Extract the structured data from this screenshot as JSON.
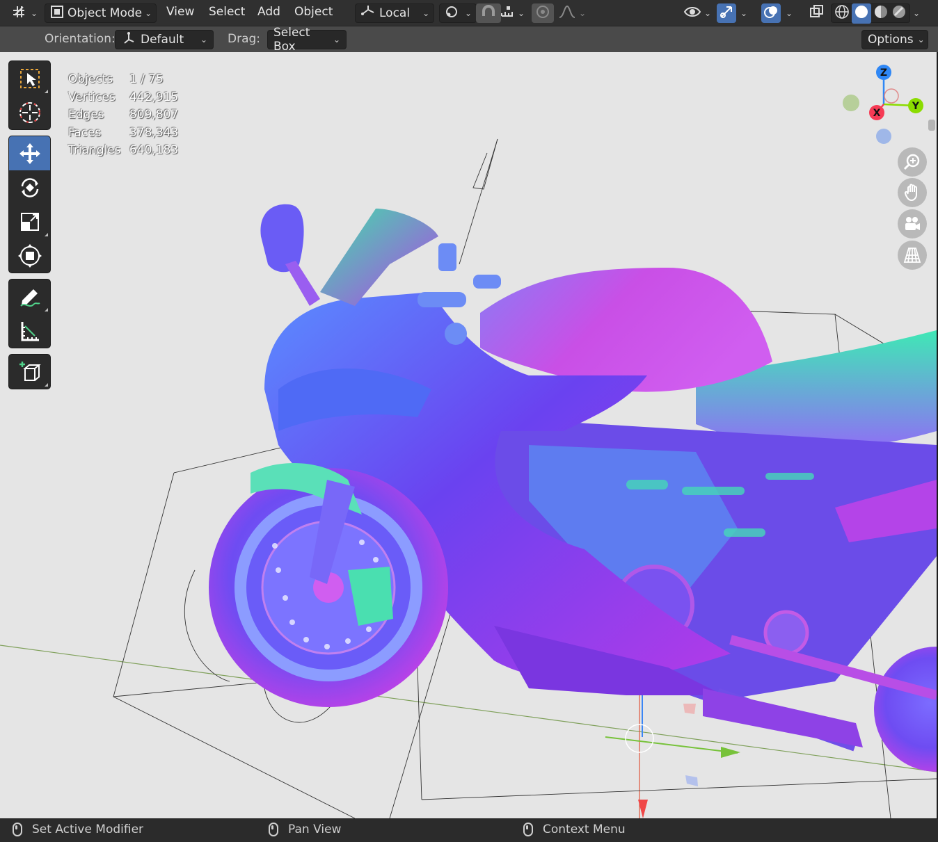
{
  "header": {
    "editor_type_icon": "axis-grid-icon",
    "mode_label": "Object Mode",
    "menus": [
      "View",
      "Select",
      "Add",
      "Object"
    ],
    "transform_orientation": "Local"
  },
  "tool_settings": {
    "orientation_label": "Orientation:",
    "orientation_value": "Default",
    "drag_label": "Drag:",
    "drag_value": "Select Box",
    "options_label": "Options"
  },
  "stats": {
    "rows": [
      {
        "label": "Objects",
        "value": "1 / 75"
      },
      {
        "label": "Vertices",
        "value": "442,915"
      },
      {
        "label": "Edges",
        "value": "809,807"
      },
      {
        "label": "Faces",
        "value": "378,343"
      },
      {
        "label": "Triangles",
        "value": "640,183"
      }
    ]
  },
  "gizmo": {
    "x_label": "X",
    "y_label": "Y",
    "z_label": "Z",
    "x_color": "#f63b55",
    "y_color": "#8bdc00",
    "z_color": "#2f87f5"
  },
  "tools": [
    {
      "name": "select-box-tool",
      "icon": "select-box-icon",
      "active": false
    },
    {
      "name": "cursor-tool",
      "icon": "cursor-icon",
      "active": false
    },
    {
      "name": "move-tool",
      "icon": "move-icon",
      "active": true
    },
    {
      "name": "rotate-tool",
      "icon": "rotate-icon",
      "active": false
    },
    {
      "name": "scale-tool",
      "icon": "scale-icon",
      "active": false
    },
    {
      "name": "transform-tool",
      "icon": "transform-icon",
      "active": false
    },
    {
      "name": "annotate-tool",
      "icon": "annotate-icon",
      "active": false
    },
    {
      "name": "measure-tool",
      "icon": "measure-icon",
      "active": false
    },
    {
      "name": "add-cube-tool",
      "icon": "add-cube-icon",
      "active": false
    }
  ],
  "status": {
    "left": "Set Active Modifier",
    "middle": "Pan View",
    "right": "Context Menu"
  },
  "colors": {
    "accent": "#4772b3",
    "viewport_bg": "#e5e5e5"
  }
}
